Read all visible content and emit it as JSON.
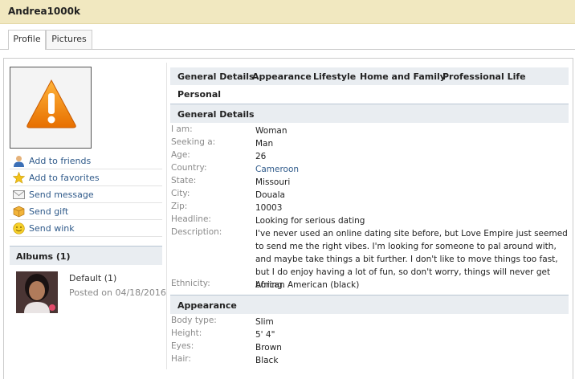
{
  "header": {
    "username": "Andrea1000k"
  },
  "tabs": [
    {
      "label": "Profile",
      "active": true
    },
    {
      "label": "Pictures",
      "active": false
    }
  ],
  "actions": [
    {
      "label": "Add to friends",
      "icon": "person-icon"
    },
    {
      "label": "Add to favorites",
      "icon": "star-icon"
    },
    {
      "label": "Send message",
      "icon": "envelope-icon"
    },
    {
      "label": "Send gift",
      "icon": "gift-icon"
    },
    {
      "label": "Send wink",
      "icon": "smiley-icon"
    }
  ],
  "albums": {
    "heading": "Albums (1)",
    "items": [
      {
        "title": "Default (1)",
        "posted": "Posted on 04/18/2016"
      }
    ]
  },
  "nav": [
    "General Details",
    "Appearance",
    "Lifestyle",
    "Home and Family",
    "Professional Life",
    "Personal"
  ],
  "general": {
    "heading": "General Details",
    "fields": [
      {
        "label": "I am:",
        "value": "Woman"
      },
      {
        "label": "Seeking a:",
        "value": "Man"
      },
      {
        "label": "Age:",
        "value": "26"
      },
      {
        "label": "Country:",
        "value": "Cameroon"
      },
      {
        "label": "State:",
        "value": "Missouri"
      },
      {
        "label": "City:",
        "value": "Douala"
      },
      {
        "label": "Zip:",
        "value": "10003"
      },
      {
        "label": "Headline:",
        "value": "Looking for serious dating"
      },
      {
        "label": "Description:",
        "value": "I've never used an online dating site before, but Love Empire just seemed to send me the right vibes. I'm looking for someone to pal around with, and maybe take things a bit further. I don't like to move things too fast, but I do enjoy having a lot of fun, so don't worry, things will never get boring."
      },
      {
        "label": "Ethnicity:",
        "value": "African American (black)"
      }
    ]
  },
  "appearance": {
    "heading": "Appearance",
    "fields": [
      {
        "label": "Body type:",
        "value": "Slim"
      },
      {
        "label": "Height:",
        "value": "5' 4\""
      },
      {
        "label": "Eyes:",
        "value": "Brown"
      },
      {
        "label": "Hair:",
        "value": "Black"
      }
    ]
  },
  "colors": {
    "accent": "#2f5a8a",
    "header_bg": "#f1e8c0",
    "section_bg": "#e9edf1",
    "warning": "#f08a10"
  }
}
